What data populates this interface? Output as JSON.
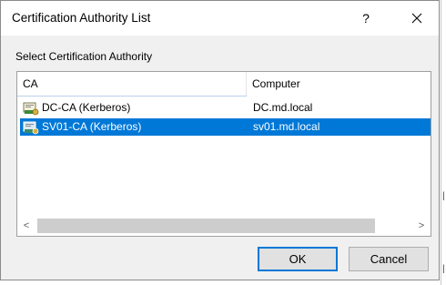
{
  "dialog": {
    "title": "Certification Authority List",
    "help_label": "?",
    "prompt": "Select Certification Authority",
    "columns": {
      "ca": "CA",
      "computer": "Computer"
    },
    "rows": [
      {
        "ca": "DC-CA (Kerberos)",
        "computer": "DC.md.local",
        "selected": false,
        "icon": "certificate-authority-icon"
      },
      {
        "ca": "SV01-CA (Kerberos)",
        "computer": "sv01.md.local",
        "selected": true,
        "icon": "certificate-authority-icon"
      }
    ],
    "scroll_left": "<",
    "scroll_right": ">",
    "ok_label": "OK",
    "cancel_label": "Cancel"
  },
  "colors": {
    "selection": "#0078d7",
    "dialog_bg": "#f0f0f0",
    "default_button_border": "#0078d7"
  }
}
